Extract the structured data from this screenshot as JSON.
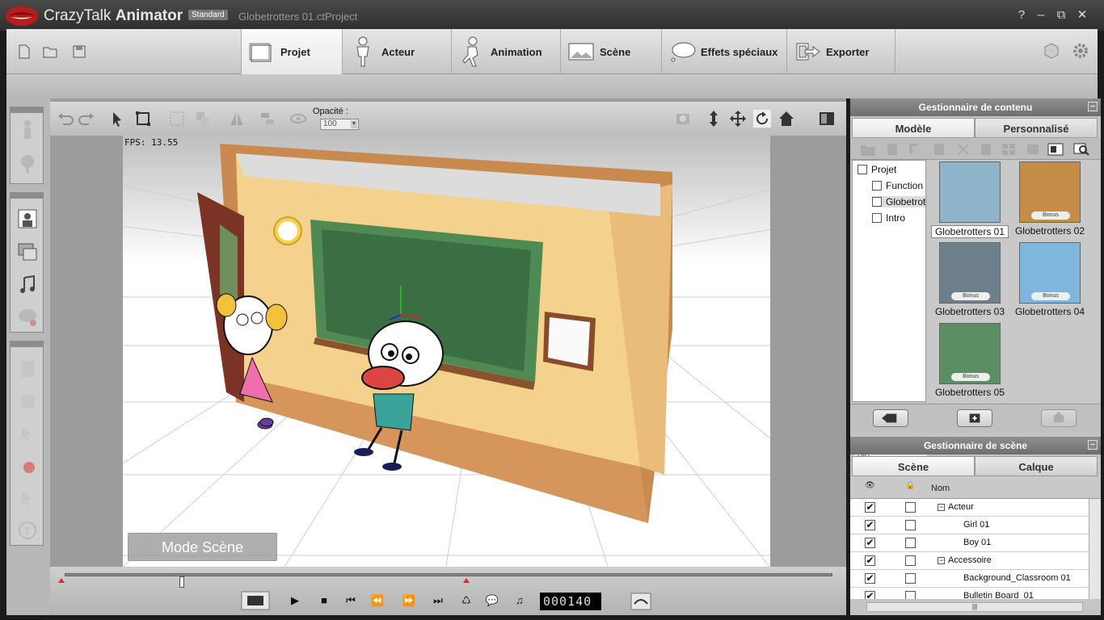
{
  "app": {
    "name_regular": "CrazyTalk",
    "name_bold": "Animator",
    "edition": "Standard",
    "project_title": "Globetrotters 01.ctProject"
  },
  "window_controls": {
    "help": "?",
    "minimize": "–",
    "restore": "⧉",
    "close": "✕"
  },
  "main_tabs": [
    {
      "label": "Projet",
      "icon": "project-icon",
      "active": true
    },
    {
      "label": "Acteur",
      "icon": "actor-icon"
    },
    {
      "label": "Animation",
      "icon": "animation-icon"
    },
    {
      "label": "Scène",
      "icon": "scene-icon"
    },
    {
      "label": "Effets spéciaux",
      "icon": "special-effects-icon"
    },
    {
      "label": "Exporter",
      "icon": "export-icon"
    }
  ],
  "viewport": {
    "opacity_label": "Opacité :",
    "opacity_value": "100",
    "fps_text": "FPS: 13.55",
    "mode_button": "Mode Scène"
  },
  "timeline": {
    "frame": "000140",
    "position": 0.15
  },
  "content_manager": {
    "title": "Gestionnaire de contenu",
    "tabs": [
      "Modèle",
      "Personnalisé"
    ],
    "tree": [
      "Projet",
      "Function",
      "Globetrot",
      "Intro"
    ],
    "thumbnails": [
      {
        "caption": "Globetrotters 01",
        "bonus": false,
        "selected": true
      },
      {
        "caption": "Globetrotters 02",
        "bonus": true
      },
      {
        "caption": "Globetrotters 03",
        "bonus": true
      },
      {
        "caption": "Globetrotters 04",
        "bonus": true
      },
      {
        "caption": "Globetrotters 05",
        "bonus": true
      }
    ],
    "bonus_label": "Bonus"
  },
  "scene_manager": {
    "title": "Gestionnaire de scène",
    "tabs": [
      "Scène",
      "Calque"
    ],
    "name_col": "Nom",
    "rows": [
      {
        "name": "Acteur",
        "group": true,
        "visible": true
      },
      {
        "name": "Girl 01",
        "group": false,
        "visible": true
      },
      {
        "name": "Boy 01",
        "group": false,
        "visible": true
      },
      {
        "name": "Accessoire",
        "group": true,
        "visible": true
      },
      {
        "name": "Background_Classroom 01",
        "group": false,
        "visible": true
      },
      {
        "name": "Bulletin Board_01",
        "group": false,
        "visible": true
      }
    ]
  },
  "colors": {
    "accent": "#3b3b3b",
    "counter_bg": "#000000",
    "marker": "#e22222"
  }
}
